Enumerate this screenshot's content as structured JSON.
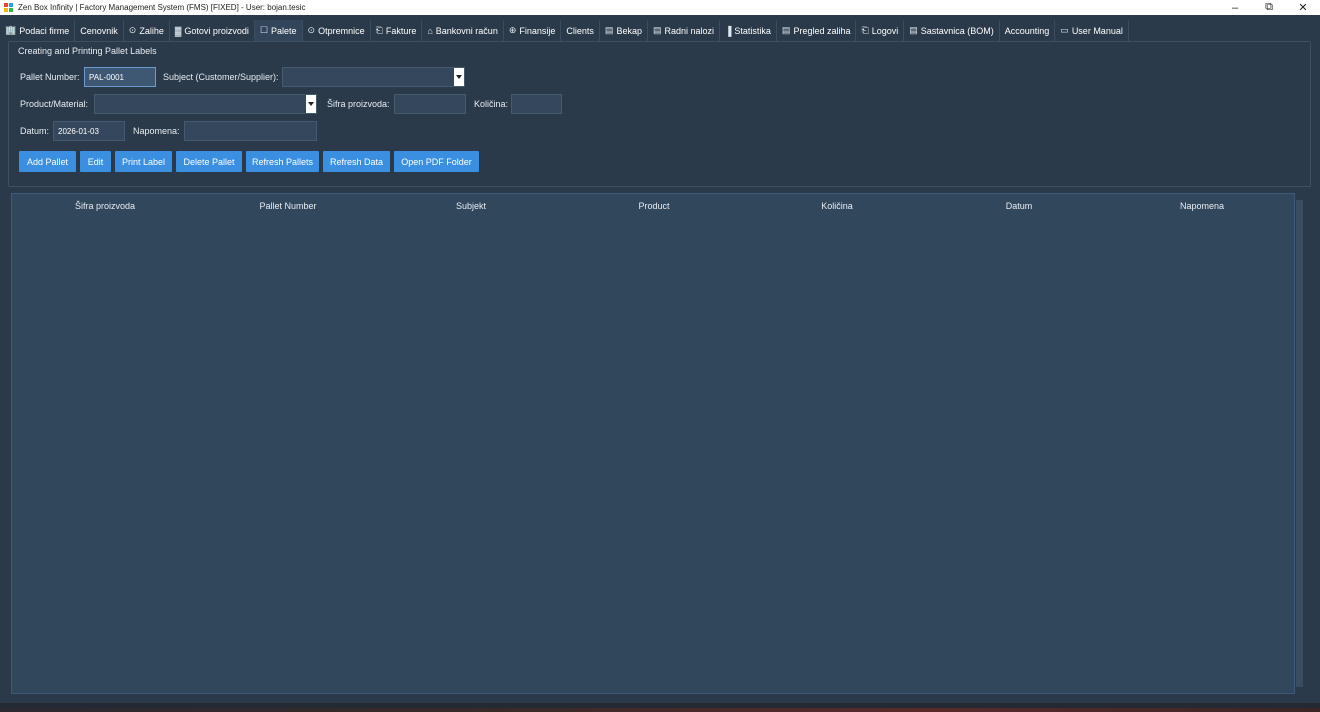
{
  "window": {
    "title": "Zen Box Infinity | Factory Management System (FMS) [FIXED] - User: bojan.tesic",
    "controls": {
      "minimize": "–",
      "maximize": "⧉",
      "close": "✕"
    }
  },
  "tabs": [
    {
      "label": "Podaci firme",
      "icon": "🏢",
      "active": false
    },
    {
      "label": "Cenovnik",
      "icon": "",
      "active": false
    },
    {
      "label": "Zalihe",
      "icon": "⊙",
      "active": false
    },
    {
      "label": "Gotovi proizvodi",
      "icon": "▓",
      "active": false
    },
    {
      "label": "Palete",
      "icon": "☐",
      "active": true
    },
    {
      "label": "Otpremnice",
      "icon": "⊙",
      "active": false
    },
    {
      "label": "Fakture",
      "icon": "⎗",
      "active": false
    },
    {
      "label": "Bankovni račun",
      "icon": "⌂",
      "active": false
    },
    {
      "label": "Finansije",
      "icon": "⊕",
      "active": false
    },
    {
      "label": "Clients",
      "icon": "",
      "active": false
    },
    {
      "label": "Bekap",
      "icon": "▤",
      "active": false
    },
    {
      "label": "Radni nalozi",
      "icon": "▤",
      "active": false
    },
    {
      "label": "Statistika",
      "icon": "▐",
      "active": false
    },
    {
      "label": "Pregled zaliha",
      "icon": "▤",
      "active": false
    },
    {
      "label": "Logovi",
      "icon": "⎗",
      "active": false
    },
    {
      "label": "Sastavnica (BOM)",
      "icon": "▤",
      "active": false
    },
    {
      "label": "Accounting",
      "icon": "",
      "active": false
    },
    {
      "label": "User Manual",
      "icon": "▭",
      "active": false
    }
  ],
  "form": {
    "section_title": "Creating and Printing Pallet Labels",
    "pallet_number_label": "Pallet Number:",
    "pallet_number_value": "PAL-0001",
    "subject_label": "Subject (Customer/Supplier):",
    "subject_value": "",
    "product_label": "Product/Material:",
    "product_value": "",
    "sifra_label": "Šifra proizvoda:",
    "sifra_value": "",
    "kolicina_label": "Količina:",
    "kolicina_value": "",
    "datum_label": "Datum:",
    "datum_value": "2026-01-03",
    "napomena_label": "Napomena:",
    "napomena_value": ""
  },
  "buttons": {
    "add_pallet": "Add Pallet",
    "edit": "Edit",
    "print_label": "Print Label",
    "delete_pallet": "Delete Pallet",
    "refresh_pallets": "Refresh Pallets",
    "refresh_data": "Refresh Data",
    "open_pdf_folder": "Open PDF Folder"
  },
  "table": {
    "columns": [
      "Šifra proizvoda",
      "Pallet Number",
      "Subjekt",
      "Product",
      "Količina",
      "Datum",
      "Napomena"
    ],
    "rows": []
  },
  "colors": {
    "background": "#2b3a4a",
    "button": "#3a8fe0",
    "table_bg": "#31475c"
  }
}
